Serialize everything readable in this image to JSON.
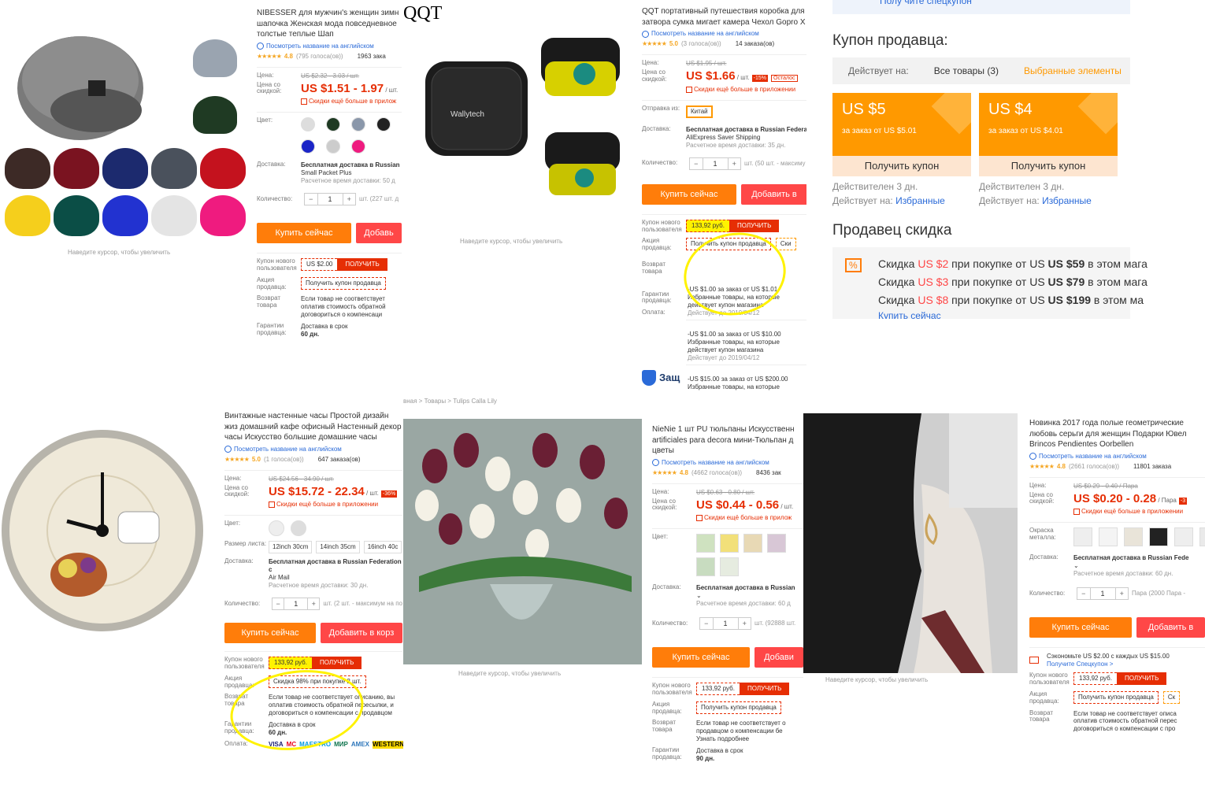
{
  "p1": {
    "title": "NIBESSER для мужчин's женщин зимн шапочка Женская мода повседневное толстые теплые Шап",
    "translate_link": "Посмотреть название на английском",
    "rating": "4.8",
    "votes": "(795 голоса(ов))",
    "orders": "1963 зака",
    "price_label": "Цена:",
    "old_price": "US $2.32 - 3.03 / шт.",
    "discount_label": "Цена со скидкой:",
    "price": "US $1.51 - 1.97",
    "unit": "/ шт.",
    "app_link": "Скидки ещё больше в прилож",
    "color_label": "Цвет:",
    "delivery_label": "Доставка:",
    "shipping": "Бесплатная доставка в Russian",
    "shipping_method": "Small Packet Plus",
    "delivery_time": "Расчетное время доставки: 50 д",
    "qty_label": "Количество:",
    "qty": "1",
    "qty_note": "шт. (227 шт. д",
    "buy": "Купить сейчас",
    "cart": "Добавь",
    "new_user_label": "Купон нового пользователя",
    "coupon_value": "US $2.00",
    "get": "ПОЛУЧИТЬ",
    "promo_label": "Акция продавца:",
    "promo": "Получить купон продавца",
    "return_label": "Возврат товара",
    "return_text": "Если товар не соответствует оплатив стоимость обратной договориться о компенсаци",
    "guarantee_label": "Гарантии продавца:",
    "guarantee": "Доставка в срок",
    "guarantee_days": "60 дн.",
    "zoom_hint": "Наведите курсор, чтобы увеличить"
  },
  "p2": {
    "brand_overlay": "QQT",
    "case_logo": "Wallytech",
    "title": "QQT портативный путешествия коробка для затвора сумка мигает камера Чехол Gopro X",
    "translate_link": "Посмотреть название на английском",
    "rating": "5.0",
    "votes": "(3 голоса(ов))",
    "orders": "14 заказа(ов)",
    "price_label": "Цена:",
    "old_price": "US $1.95 / шт.",
    "discount_label": "Цена со скидкой:",
    "price": "US $1.66",
    "unit": "/ шт.",
    "badge": "-15%",
    "remain": "Осталос",
    "app_link": "Скидки ещё больше в приложении",
    "ship_from_label": "Отправка из:",
    "ship_from": "Китай",
    "delivery_label": "Доставка:",
    "shipping": "Бесплатная доставка в Russian Federa",
    "shipping_method": "AliExpress Saver Shipping",
    "delivery_time": "Расчетное время доставки: 35 дн.",
    "qty_label": "Количество:",
    "qty": "1",
    "qty_note": "шт. (50 шт. - максиму",
    "buy": "Купить сейчас",
    "cart": "Добавить в",
    "new_user_label": "Купон нового пользователя",
    "coupon_value": "133,92 руб.",
    "get": "ПОЛУЧИТЬ",
    "promo_label": "Акция продавца:",
    "promo": "Получить купон продавца",
    "promo2": "Ски",
    "drop1": "-US $1.00 за заказ от US $1.01 Избранные товары, на которые действует купон магазина",
    "drop1_date": "Действует до 2019/04/12",
    "drop2": "-US $1.00 за заказ от US $10.00 Избранные товары, на которые действует купон магазина",
    "drop2_date": "Действует до 2019/04/12",
    "drop3": "-US $15.00 за заказ от US $200.00 Избранные товары, на которые",
    "return_label": "Возврат товара",
    "guarantee_label": "Гарантии продавца:",
    "pay_label": "Оплата:",
    "protect": "Защ",
    "zoom_hint": "Наведите курсор, чтобы увеличить"
  },
  "p3": {
    "title_top": "Полу чите спецкупон",
    "seller_coupon_title": "Купон продавца:",
    "applies_label": "Действует на:",
    "tab_all": "Все товары (3)",
    "tab_selected": "Выбранные элементы",
    "coupons": [
      {
        "amount": "US $5",
        "min": "за заказ от US $5.01",
        "button": "Получить купон",
        "valid": "Действителен 3 дн.",
        "applies": "Действует на:",
        "applies_link": "Избранные"
      },
      {
        "amount": "US $4",
        "min": "за заказ от US $4.01",
        "button": "Получить купон",
        "valid": "Действителен 3 дн.",
        "applies": "Действует на:",
        "applies_link": "Избранные"
      }
    ],
    "discount_title": "Продавец скидка",
    "disc_icon": "%",
    "discounts": [
      {
        "pre": "Скидка",
        "amt": "US $2",
        "mid": "при покупке от US",
        "min": "US $59",
        "post": "в этом мага"
      },
      {
        "pre": "Скидка",
        "amt": "US $3",
        "mid": "при покупке от US",
        "min": "US $79",
        "post": "в этом мага"
      },
      {
        "pre": "Скидка",
        "amt": "US $8",
        "mid": "при покупке от US",
        "min": "US $199",
        "post": "в этом ма"
      }
    ],
    "buy_link": "Купить сейчас"
  },
  "p4": {
    "title": "Винтажные настенные часы Простой дизайн жиз домашний кафе офисный Настенный декор часы Искусство большие домашние часы",
    "translate_link": "Посмотреть название на английском",
    "rating": "5.0",
    "votes": "(1 голоса(ов))",
    "orders": "647 заказа(ов)",
    "price_label": "Цена:",
    "old_price": "US $24.56 - 34.90 / шт.",
    "discount_label": "Цена со скидкой:",
    "price": "US $15.72 - 22.34",
    "unit": "/ шт.",
    "badge": "-36%",
    "app_link": "Скидки ещё больше в приложении",
    "color_label": "Цвет:",
    "size_label": "Размер листа:",
    "sizes": [
      "12inch 30cm",
      "14inch 35cm",
      "16inch 40c"
    ],
    "delivery_label": "Доставка:",
    "shipping": "Бесплатная доставка в Russian Federation c",
    "shipping_method": "Air Mail",
    "delivery_time": "Расчетное время доставки: 30 дн.",
    "qty_label": "Количество:",
    "qty": "1",
    "qty_note": "шт. (2 шт. - максимум на по",
    "buy": "Купить сейчас",
    "cart": "Добавить в корз",
    "new_user_label": "Купон нового пользователя",
    "coupon_value": "133,92 руб.",
    "get": "ПОЛУЧИТЬ",
    "promo_label": "Акция продавца:",
    "promo": "Скидка 98% при покупке 2 шт.",
    "return_label": "Возврат товара",
    "return_text": "Если товар не соответствует описанию, вы оплатив стоимость обратной пересылки, и договориться о компенсации с продавцом",
    "guarantee_label": "Гарантии продавца:",
    "guarantee": "Доставка в срок",
    "guarantee_days": "60 дн.",
    "pay_label": "Оплата:",
    "pay_methods": [
      "VISA",
      "MC",
      "MAESTRO",
      "МИР",
      "AMEX",
      "WESTERN"
    ]
  },
  "p5": {
    "breadcrumb": "вная > Товары > Tulips Calla Lily",
    "title": "NieNie 1 шт PU тюльпаны Искусственн artificiales para decora мини-Тюльпан д цветы",
    "translate_link": "Посмотреть название на английском",
    "rating": "4.8",
    "votes": "(4662 голоса(ов))",
    "orders": "8436 зак",
    "price_label": "Цена:",
    "old_price": "US $0.63 - 0.80 / шт.",
    "discount_label": "Цена со скидкой:",
    "price": "US $0.44 - 0.56",
    "unit": "/ шт.",
    "app_link": "Скидки ещё больше в прилож",
    "color_label": "Цвет:",
    "delivery_label": "Доставка:",
    "shipping": "Бесплатная доставка в Russian",
    "delivery_time": "Расчетное время доставки: 60 д",
    "qty_label": "Количество:",
    "qty": "1",
    "qty_note": "шт. (92888 шт.",
    "buy": "Купить сейчас",
    "cart": "Добави",
    "new_user_label": "Купон нового пользователя",
    "coupon_value": "133,92 руб.",
    "get": "ПОЛУЧИТЬ",
    "promo_label": "Акция продавца:",
    "promo": "Получить купон продавца",
    "return_label": "Возврат товара",
    "return_text": "Если товар не соответствует о продавцом о компенсации бе Узнать подробнее",
    "guarantee_label": "Гарантии продавца:",
    "guarantee": "Доставка в срок",
    "guarantee_days": "90 дн.",
    "zoom_hint": "Наведите курсор, чтобы увеличить"
  },
  "p6": {
    "title": "Новинка 2017 года полые геометрические любовь серьги для женщин Подарки Ювел Brincos Pendientes Oorbellen",
    "translate_link": "Посмотреть название на английском",
    "rating": "4.8",
    "votes": "(2661 голоса(ов))",
    "orders": "11801 заказа",
    "price_label": "Цена:",
    "old_price": "US $0.29 - 0.40 / Пара",
    "discount_label": "Цена со скидкой:",
    "price": "US $0.20 - 0.28",
    "unit": "/ Пара",
    "badge": "-3",
    "app_link": "Скидки ещё больше в приложении",
    "color_label": "Окраска металла:",
    "delivery_label": "Доставка:",
    "shipping": "Бесплатная доставка в Russian Fede",
    "delivery_time": "Расчетное время доставки: 60 дн.",
    "qty_label": "Количество:",
    "qty": "1",
    "qty_note": "Пара (2000 Пара -",
    "buy": "Купить сейчас",
    "cart": "Добавить в",
    "save_text": "Сэкономьте US $2.00 с каждых US $15.00",
    "save_link": "Получите Спецкупон >",
    "new_user_label": "Купон нового пользователя",
    "coupon_value": "133,92 руб.",
    "get": "ПОЛУЧИТЬ",
    "promo_label": "Акция продавца:",
    "promo": "Получить купон продавца",
    "promo2": "Ск",
    "return_label": "Возврат товара",
    "return_text": "Если товар не соответствует описа оплатив стоимость обратной перес договориться о компенсации с про",
    "zoom_hint": "Наведите курсор, чтобы увеличить"
  },
  "colors": {
    "accent_orange": "#ff7d0a",
    "price_red": "#e62e04",
    "cart_red": "#ff4747",
    "coupon_orange": "#ff9900",
    "link_blue": "#2a6ad8",
    "highlight": "#fff200"
  }
}
